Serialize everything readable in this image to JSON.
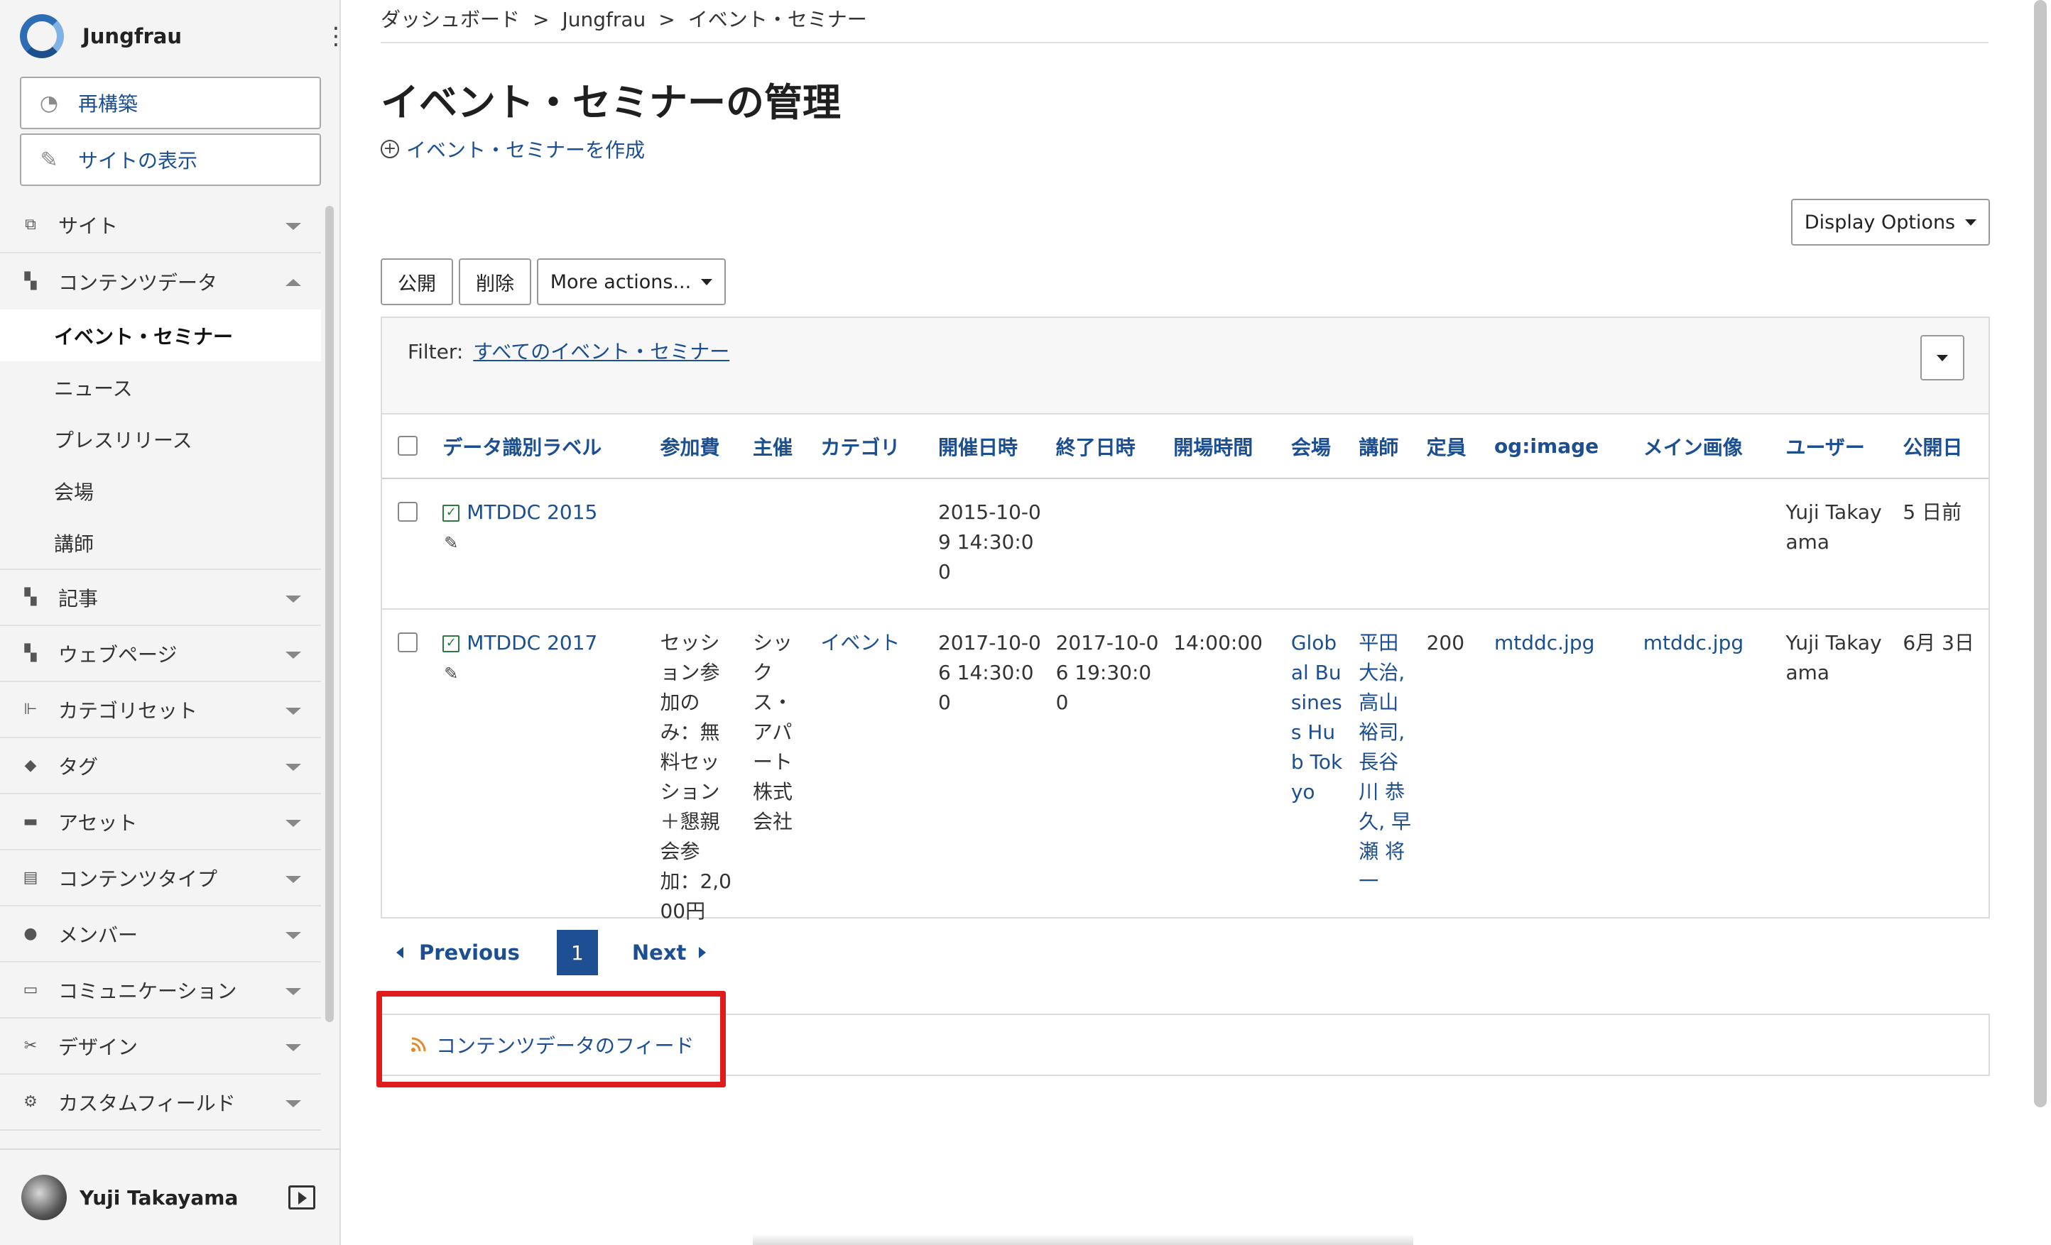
{
  "app": {
    "name": "Jungfrau"
  },
  "sidebar": {
    "rebuild_label": "再構築",
    "view_site_label": "サイトの表示",
    "nav": [
      {
        "label": "サイト",
        "icon": "site-icon",
        "expanded": false
      },
      {
        "label": "コンテンツデータ",
        "icon": "content-data-icon",
        "expanded": true,
        "children": [
          "イベント・セミナー",
          "ニュース",
          "プレスリリース",
          "会場",
          "講師"
        ]
      },
      {
        "label": "記事",
        "icon": "entry-icon",
        "expanded": false
      },
      {
        "label": "ウェブページ",
        "icon": "page-icon",
        "expanded": false
      },
      {
        "label": "カテゴリセット",
        "icon": "category-set-icon",
        "expanded": false
      },
      {
        "label": "タグ",
        "icon": "tag-icon",
        "expanded": false
      },
      {
        "label": "アセット",
        "icon": "asset-icon",
        "expanded": false
      },
      {
        "label": "コンテンツタイプ",
        "icon": "content-type-icon",
        "expanded": false
      },
      {
        "label": "メンバー",
        "icon": "member-icon",
        "expanded": false
      },
      {
        "label": "コミュニケーション",
        "icon": "communication-icon",
        "expanded": false
      },
      {
        "label": "デザイン",
        "icon": "design-icon",
        "expanded": false
      },
      {
        "label": "カスタムフィールド",
        "icon": "custom-field-icon",
        "expanded": false
      }
    ],
    "active_child": "イベント・セミナー",
    "user": "Yuji Takayama"
  },
  "breadcrumb": [
    "ダッシュボード",
    "Jungfrau",
    "イベント・セミナー"
  ],
  "breadcrumb_sep": ">",
  "page_title": "イベント・セミナーの管理",
  "create_link": "イベント・セミナーを作成",
  "display_options": "Display Options",
  "actions": {
    "publish": "公開",
    "delete": "削除",
    "more": "More actions..."
  },
  "filter": {
    "label": "Filter:",
    "value": "すべてのイベント・セミナー"
  },
  "table": {
    "headers": [
      "データ識別ラベル",
      "参加費",
      "主催",
      "カテゴリ",
      "開催日時",
      "終了日時",
      "開場時間",
      "会場",
      "講師",
      "定員",
      "og:image",
      "メイン画像",
      "ユーザー",
      "公開日"
    ],
    "rows": [
      {
        "label": "MTDDC 2015",
        "fee": "",
        "organizer": "",
        "category": "",
        "start": "2015-10-09 14:30:00",
        "end": "",
        "open": "",
        "venue": "",
        "speakers": "",
        "capacity": "",
        "og_image": "",
        "main_image": "",
        "user": "Yuji Takayama",
        "published": "5 日前"
      },
      {
        "label": "MTDDC 2017",
        "fee": "セッション参加のみ：無料セッション＋懇親会参加：2,000円",
        "organizer": "シックス・アパート株式会社",
        "category": "イベント",
        "start": "2017-10-06 14:30:00",
        "end": "2017-10-06 19:30:00",
        "open": "14:00:00",
        "venue": "Global Business Hub Tokyo",
        "speakers": "平田 大治, 高山 裕司, 長谷川 恭久, 早瀬 将一",
        "capacity": "200",
        "og_image": "mtddc.jpg",
        "main_image": "mtddc.jpg",
        "user": "Yuji Takayama",
        "published": "6月 3日"
      }
    ]
  },
  "pager": {
    "previous": "Previous",
    "current": "1",
    "next": "Next"
  },
  "feed_label": "コンテンツデータのフィード",
  "colors": {
    "link": "#1c4f91",
    "highlight": "#e01b1b",
    "page_active": "#1e4f93",
    "rss": "#e58a2b"
  }
}
